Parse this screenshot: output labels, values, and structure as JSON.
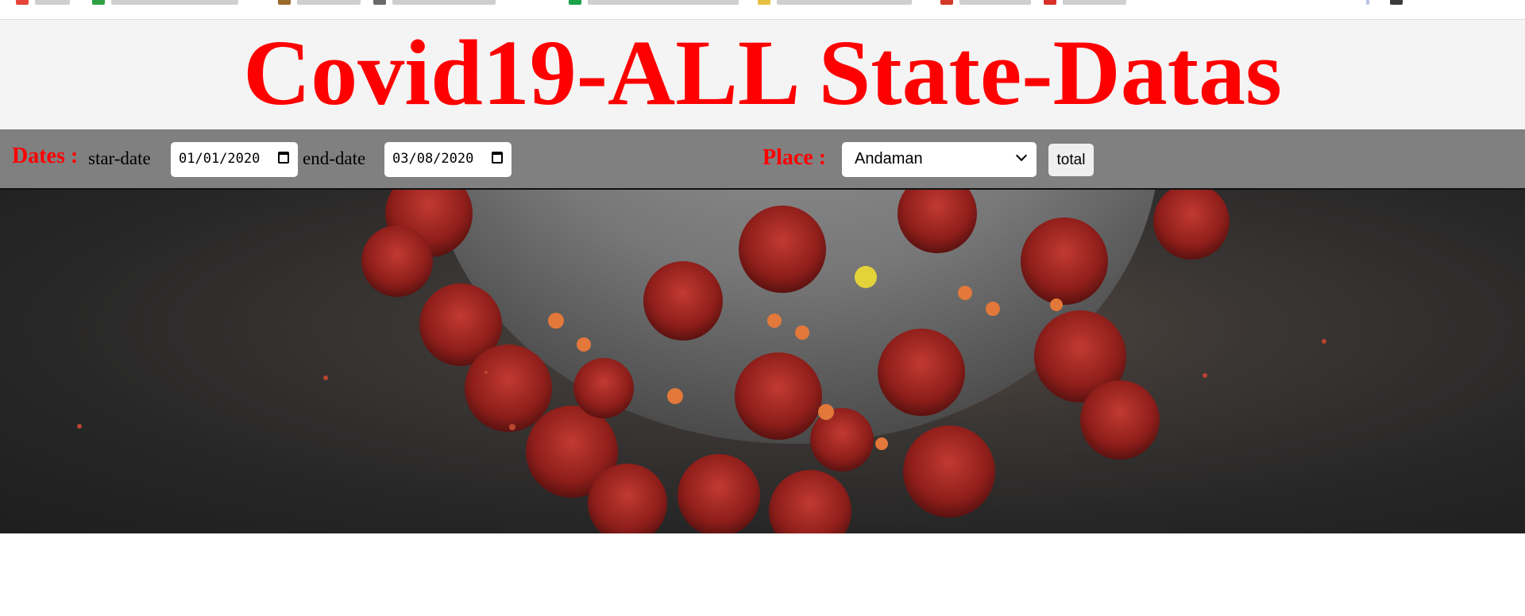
{
  "page": {
    "title": "Covid19-ALL State-Datas"
  },
  "filters": {
    "dates_label": "Dates :",
    "start_label": "star-date",
    "start_value": "01/01/2020",
    "end_label": "end-date",
    "end_value": "03/08/2020",
    "place_label": "Place :",
    "place_selected": "Andaman",
    "total_button": "total"
  },
  "banner": {
    "image": "coronavirus-illustration"
  },
  "colors": {
    "title": "#ff0000",
    "toolbar_bg": "#808080",
    "header_bg": "#f4f4f4"
  }
}
